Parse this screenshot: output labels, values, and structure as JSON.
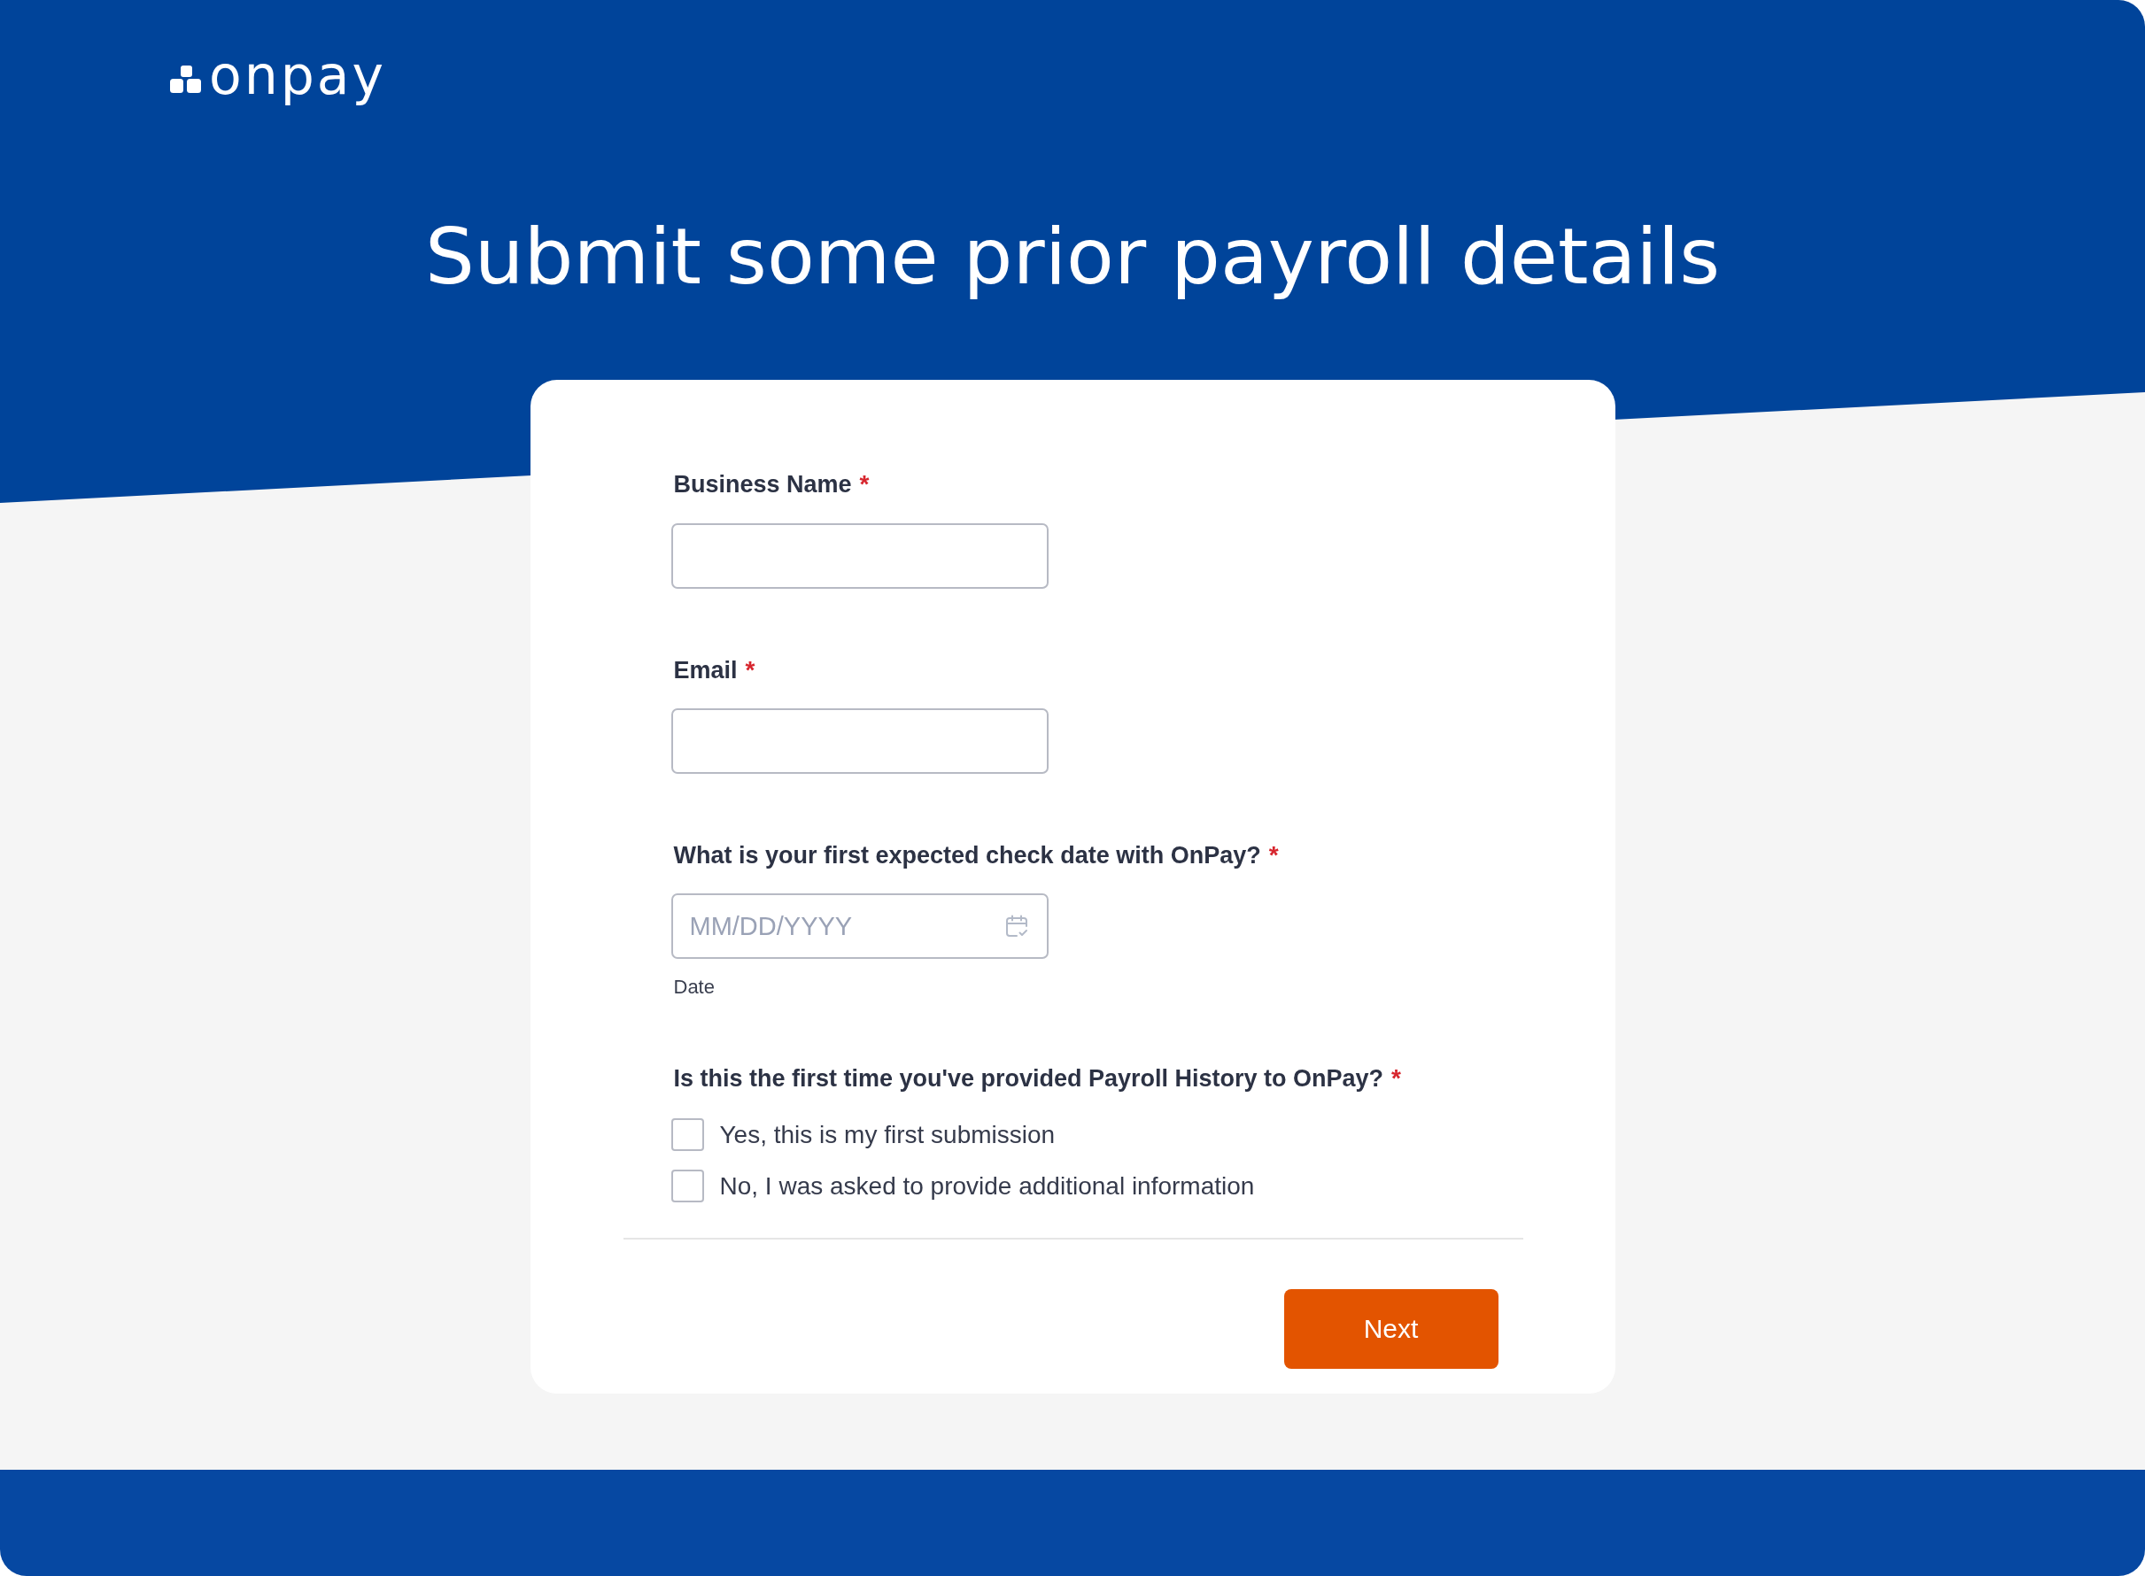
{
  "logo": {
    "text": "onpay"
  },
  "title": "Submit some prior payroll details",
  "form": {
    "fields": [
      {
        "kind": "text",
        "label": "Business Name",
        "required_mark": "*"
      },
      {
        "kind": "text",
        "label": "Email",
        "required_mark": "*"
      },
      {
        "kind": "date",
        "label": "What is your first expected check date with OnPay?",
        "required_mark": "*",
        "placeholder": "MM/DD/YYYY",
        "helper": "Date"
      },
      {
        "kind": "checkboxes",
        "label": "Is this the first time you've provided Payroll History to OnPay?",
        "required_mark": "*",
        "options": [
          {
            "label": "Yes, this is my first submission",
            "checked": false
          },
          {
            "label": "No, I was asked to provide additional information",
            "checked": false
          }
        ]
      }
    ],
    "submit": "Next"
  }
}
